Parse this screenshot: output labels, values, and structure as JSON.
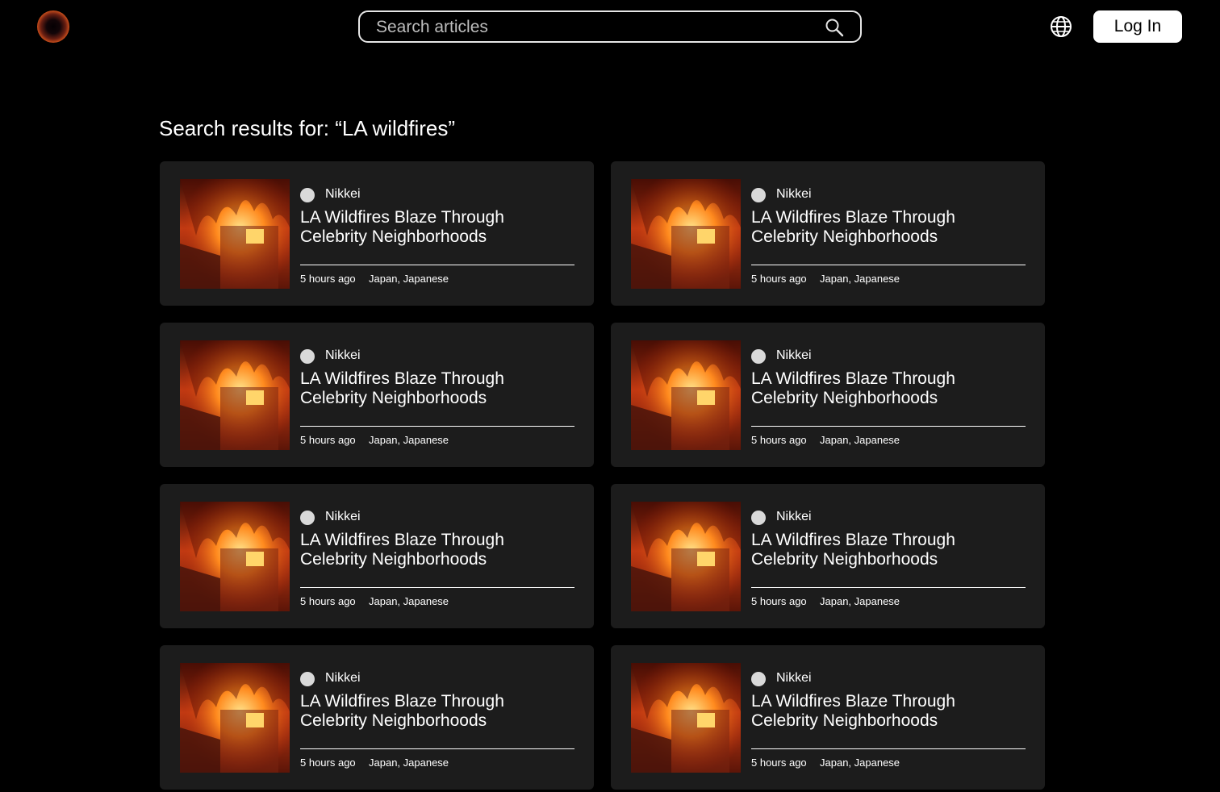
{
  "header": {
    "logo_icon": "sun-eclipse-logo",
    "search_placeholder": "Search articles",
    "search_icon": "search-icon",
    "globe_icon": "globe-icon",
    "login_label": "Log In"
  },
  "results": {
    "heading": "Search results for: “LA wildfires”",
    "articles": [
      {
        "source": "Nikkei",
        "title": "LA Wildfires Blaze Through Celebrity Neighborhoods",
        "time": "5 hours ago",
        "region": "Japan, Japanese"
      },
      {
        "source": "Nikkei",
        "title": "LA Wildfires Blaze Through Celebrity Neighborhoods",
        "time": "5 hours ago",
        "region": "Japan, Japanese"
      },
      {
        "source": "Nikkei",
        "title": "LA Wildfires Blaze Through Celebrity Neighborhoods",
        "time": "5 hours ago",
        "region": "Japan, Japanese"
      },
      {
        "source": "Nikkei",
        "title": "LA Wildfires Blaze Through Celebrity Neighborhoods",
        "time": "5 hours ago",
        "region": "Japan, Japanese"
      },
      {
        "source": "Nikkei",
        "title": "LA Wildfires Blaze Through Celebrity Neighborhoods",
        "time": "5 hours ago",
        "region": "Japan, Japanese"
      },
      {
        "source": "Nikkei",
        "title": "LA Wildfires Blaze Through Celebrity Neighborhoods",
        "time": "5 hours ago",
        "region": "Japan, Japanese"
      },
      {
        "source": "Nikkei",
        "title": "LA Wildfires Blaze Through Celebrity Neighborhoods",
        "time": "5 hours ago",
        "region": "Japan, Japanese"
      },
      {
        "source": "Nikkei",
        "title": "LA Wildfires Blaze Through Celebrity Neighborhoods",
        "time": "5 hours ago",
        "region": "Japan, Japanese"
      }
    ]
  },
  "colors": {
    "background": "#000000",
    "card": "#1c1c1c",
    "text": "#ffffff",
    "button_bg": "#ffffff",
    "button_text": "#000000"
  }
}
